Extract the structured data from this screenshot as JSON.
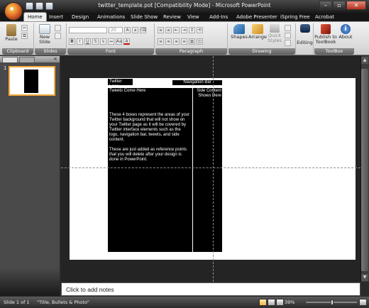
{
  "window": {
    "title": "twitter_template.pot [Compatibility Mode] - Microsoft PowerPoint",
    "controls": [
      "–",
      "▫",
      "✕"
    ]
  },
  "ribbon_tabs": [
    "Home",
    "Insert",
    "Design",
    "Animations",
    "Slide Show",
    "Review",
    "View",
    "Add-Ins",
    "Adobe Presenter",
    "iSpring Free",
    "Acrobat"
  ],
  "ribbon": {
    "clipboard": {
      "label": "Clipboard",
      "paste": "Paste"
    },
    "slides": {
      "label": "Slides",
      "new_slide_1": "New",
      "new_slide_2": "Slide"
    },
    "font": {
      "label": "Font",
      "size": "20"
    },
    "paragraph": {
      "label": "Paragraph"
    },
    "drawing": {
      "label": "Drawing",
      "shapes": "Shapes",
      "arrange": "Arrange",
      "quick_1": "Quick",
      "quick_2": "Styles"
    },
    "editing": {
      "label": "Editing"
    },
    "toolbox": {
      "label": "ToolBox",
      "publish_1": "Publish to",
      "publish_2": "ToolBook",
      "about": "About"
    }
  },
  "slides_pane": {
    "slide_number": "1",
    "close": "×"
  },
  "slide": {
    "logo": "Twitter Logo",
    "nav": "Navigation Bar",
    "tweets": "Tweets Come Here",
    "side_1": "Side Content",
    "side_2": "Shows Here",
    "para1": "These 4 boxes represent the areas of your Twitter background that will not show on your Twitter page as it will  be covered by Twitter interface elements such as the logo, navigation bar, tweets, and side content.",
    "para2": "These are just added as reference points that you will delete after your design is done in PowerPoint."
  },
  "notes_placeholder": "Click to add notes",
  "status": {
    "slide": "Slide 1 of 1",
    "theme": "\"Title, Bullets & Photo\"",
    "zoom": "39%"
  },
  "colors": {
    "accent": "#f4a93a",
    "slide_blocks": "#000000"
  }
}
